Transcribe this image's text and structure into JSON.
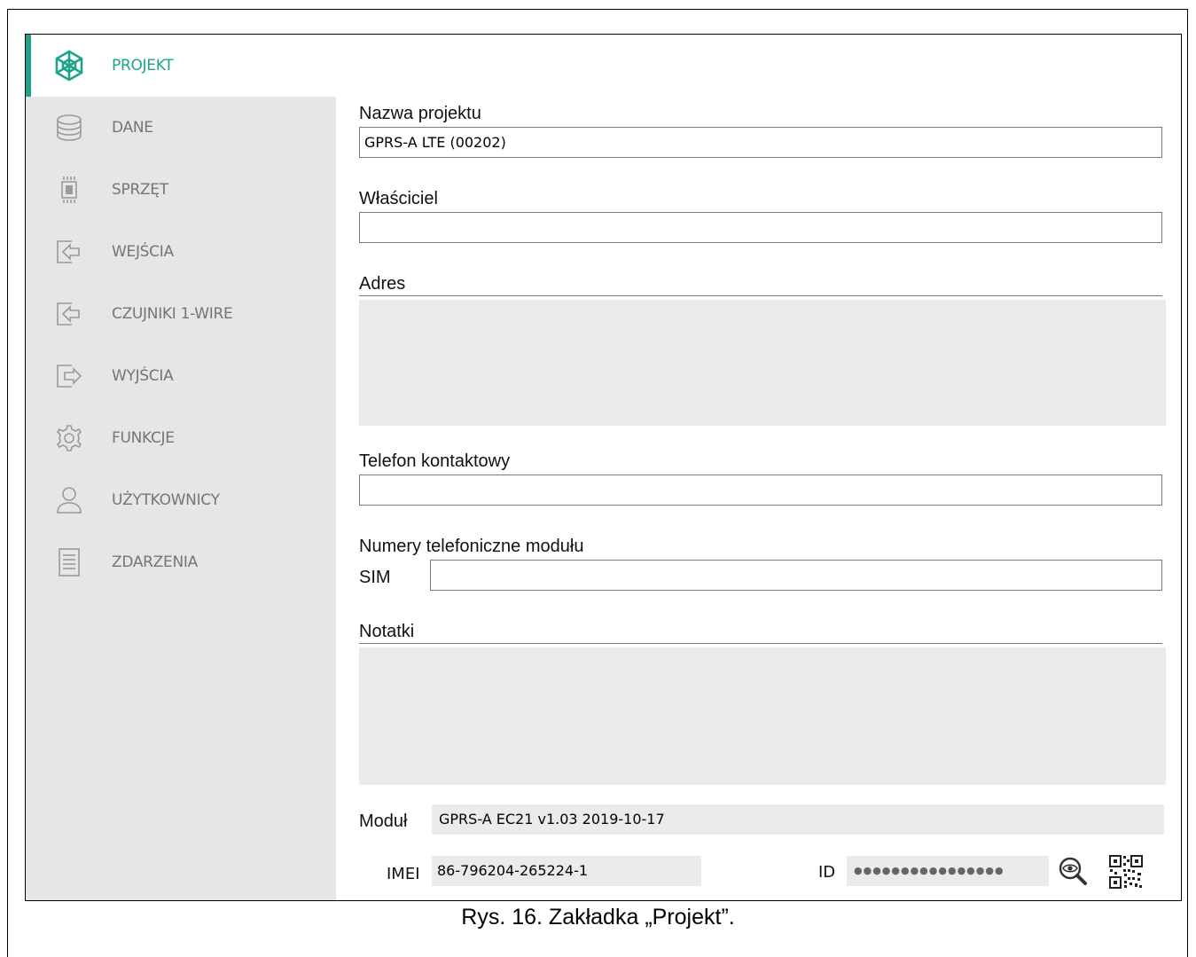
{
  "sidebar": {
    "items": [
      {
        "label": "PROJEKT",
        "icon": "project-logo-icon",
        "active": true
      },
      {
        "label": "DANE",
        "icon": "database-icon"
      },
      {
        "label": "SPRZĘT",
        "icon": "chip-icon"
      },
      {
        "label": "WEJŚCIA",
        "icon": "input-icon"
      },
      {
        "label": "CZUJNIKI 1-WIRE",
        "icon": "sensor-input-icon"
      },
      {
        "label": "WYJŚCIA",
        "icon": "output-icon"
      },
      {
        "label": "FUNKCJE",
        "icon": "gear-icon"
      },
      {
        "label": "UŻYTKOWNICY",
        "icon": "user-icon"
      },
      {
        "label": "ZDARZENIA",
        "icon": "document-icon"
      }
    ],
    "accent_color": "#1ea38c"
  },
  "form": {
    "project_name": {
      "label": "Nazwa projektu",
      "value": "GPRS-A LTE (00202)"
    },
    "owner": {
      "label": "Właściciel",
      "value": ""
    },
    "address": {
      "label": "Adres",
      "value": ""
    },
    "contact_phone": {
      "label": "Telefon kontaktowy",
      "value": ""
    },
    "module_numbers": {
      "label": "Numery telefoniczne modułu",
      "sim_label": "SIM",
      "sim_value": ""
    },
    "notes": {
      "label": "Notatki",
      "value": ""
    },
    "module": {
      "label": "Moduł",
      "value": "GPRS-A EC21 v1.03 2019-10-17"
    },
    "imei": {
      "label": "IMEI",
      "value": "86-796204-265224-1"
    },
    "id": {
      "label": "ID",
      "value": "●●●●●●●●●●●●●●●●"
    }
  },
  "caption": "Rys. 16. Zakładka „Projekt”."
}
